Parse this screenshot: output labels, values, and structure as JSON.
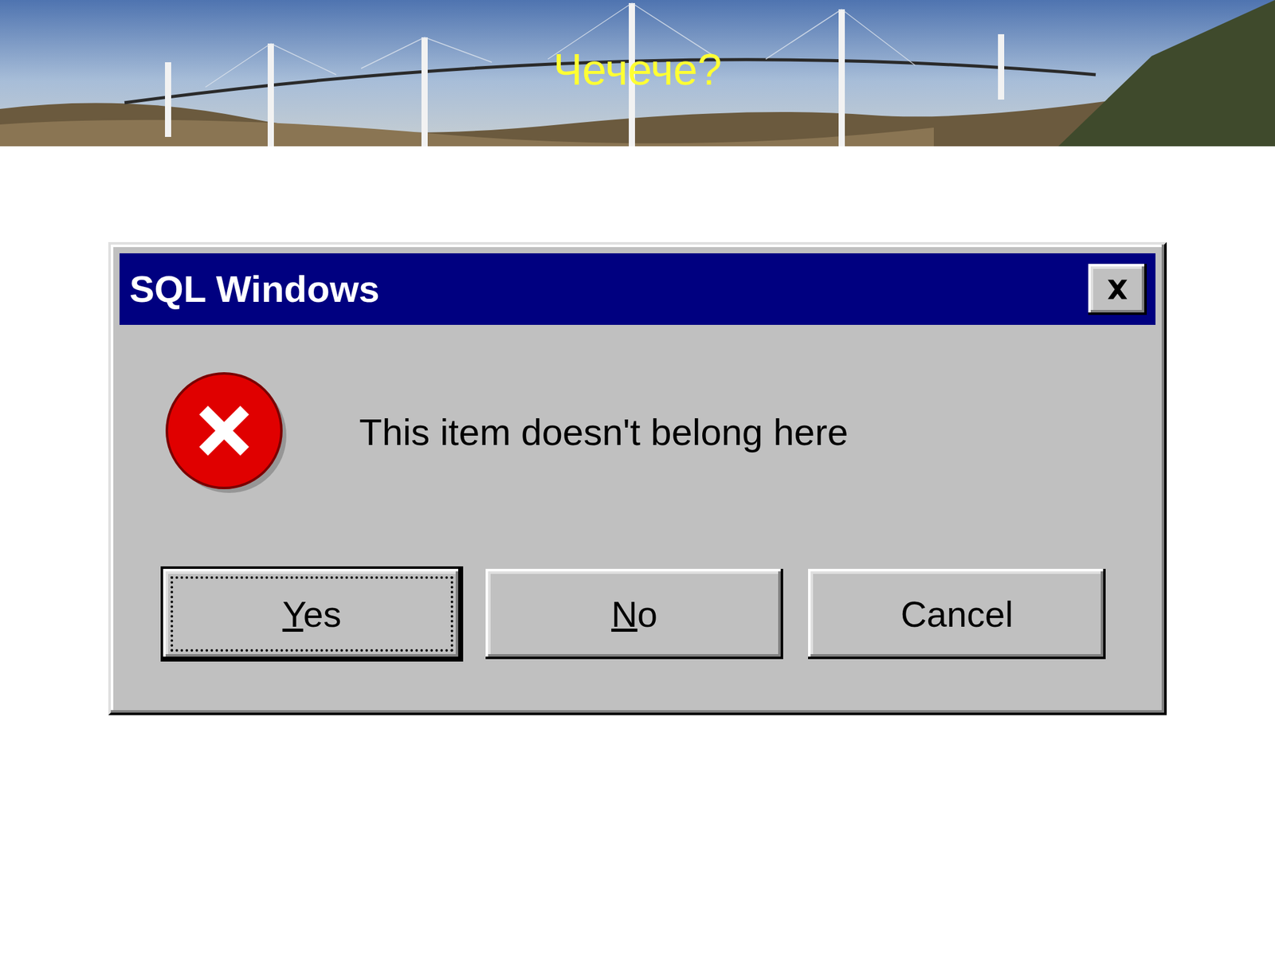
{
  "slide": {
    "title": "Чечече?"
  },
  "dialog": {
    "title": "SQL Windows",
    "message": "This item doesn't belong here",
    "buttons": [
      {
        "label": "Yes",
        "default": true,
        "focused": true,
        "mnemonic_index": 0
      },
      {
        "label": "No",
        "default": false,
        "focused": false,
        "mnemonic_index": 0
      },
      {
        "label": "Cancel",
        "default": false,
        "focused": false,
        "mnemonic_index": -1
      }
    ]
  }
}
